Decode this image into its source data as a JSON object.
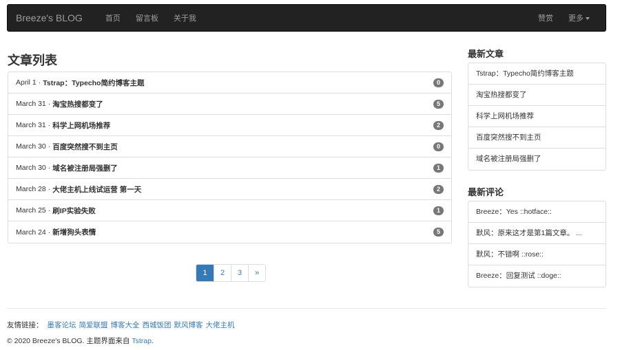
{
  "navbar": {
    "brand": "Breeze's BLOG",
    "links": [
      "首页",
      "留言板",
      "关于我"
    ],
    "right": {
      "donate": "赞赏",
      "more": "更多"
    }
  },
  "main": {
    "title": "文章列表",
    "posts": [
      {
        "date": "April 1",
        "title": "Tstrap：Typecho简约博客主题",
        "comments": "0"
      },
      {
        "date": "March 31",
        "title": "淘宝热搜都变了",
        "comments": "5"
      },
      {
        "date": "March 31",
        "title": "科学上网机场推荐",
        "comments": "2"
      },
      {
        "date": "March 30",
        "title": "百度突然搜不到主页",
        "comments": "0"
      },
      {
        "date": "March 30",
        "title": "域名被注册局强删了",
        "comments": "1"
      },
      {
        "date": "March 28",
        "title": "大佬主机上线试运营 第一天",
        "comments": "2"
      },
      {
        "date": "March 25",
        "title": "刷IP实验失败",
        "comments": "1"
      },
      {
        "date": "March 24",
        "title": "新增狗头表情",
        "comments": "5"
      }
    ],
    "separator": "·",
    "pagination": [
      "1",
      "2",
      "3",
      "»"
    ]
  },
  "sidebar": {
    "recent_posts_heading": "最新文章",
    "recent_posts": [
      "Tstrap：Typecho简约博客主题",
      "淘宝热搜都变了",
      "科学上网机场推荐",
      "百度突然搜不到主页",
      "域名被注册局强删了"
    ],
    "recent_comments_heading": "最新评论",
    "recent_comments": [
      "Breeze：Yes ::hotface::",
      "默风：原来这才是第1篇文章。 ...",
      "默风：不错啊 ::rose::",
      "Breeze：回复测试 ::doge::"
    ]
  },
  "footer": {
    "friends_label": "友情链接：",
    "friends": [
      "墨客论坛",
      "简爱联盟",
      "博客大全",
      "西城饭团",
      "默风博客",
      "大佬主机"
    ],
    "copyright_prefix": "© 2020 Breeze's BLOG.  主题界面来自 ",
    "theme_link": "Tstrap",
    "copyright_suffix": "."
  },
  "colors": {
    "navbar_bg": "#222222",
    "link": "#337ab7",
    "badge": "#777777",
    "active_page": "#337ab7"
  }
}
